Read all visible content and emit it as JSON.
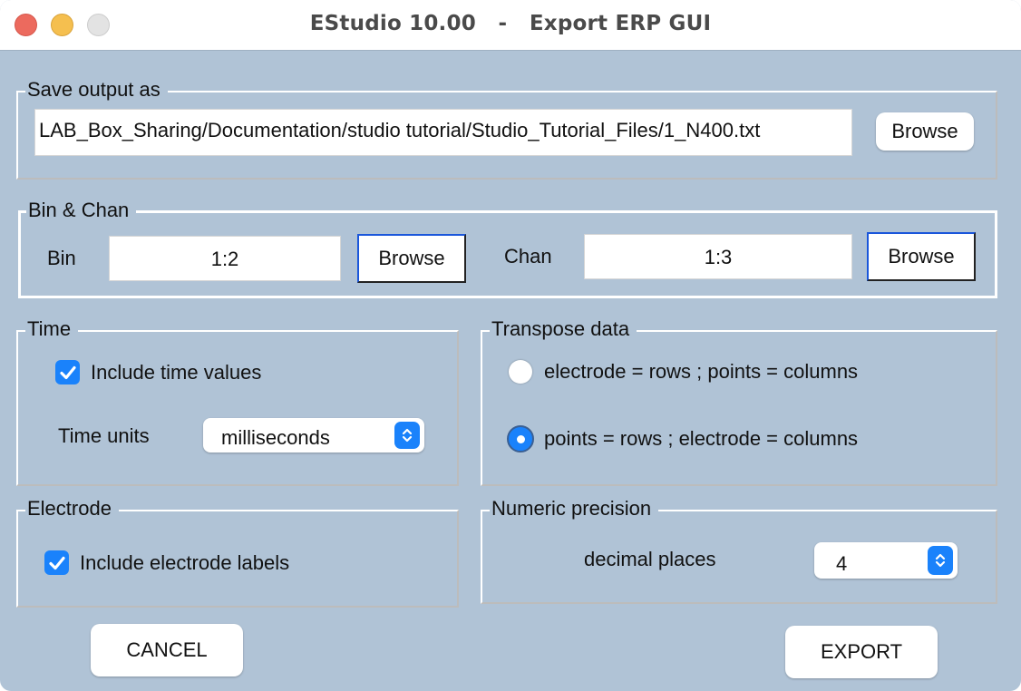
{
  "window": {
    "title": "EStudio 10.00   -   Export ERP GUI",
    "controls": [
      "close",
      "minimize",
      "maximize"
    ]
  },
  "save_output": {
    "title": "Save output as",
    "path_value": "LAB_Box_Sharing/Documentation/studio tutorial/Studio_Tutorial_Files/1_N400.txt",
    "browse_label": "Browse"
  },
  "bin_chan": {
    "title": "Bin & Chan",
    "bin_label": "Bin",
    "bin_value": "1:2",
    "bin_browse_label": "Browse",
    "chan_label": "Chan",
    "chan_value": "1:3",
    "chan_browse_label": "Browse"
  },
  "time": {
    "title": "Time",
    "include_time_label": "Include time values",
    "include_time_checked": true,
    "units_label": "Time units",
    "units_selected": "milliseconds"
  },
  "transpose": {
    "title": "Transpose data",
    "options": [
      {
        "label": "electrode = rows ; points = columns",
        "selected": false
      },
      {
        "label": "points = rows ; electrode = columns",
        "selected": true
      }
    ]
  },
  "electrode": {
    "title": "Electrode",
    "include_labels_label": "Include electrode labels",
    "include_labels_checked": true
  },
  "precision": {
    "title": "Numeric precision",
    "decimal_label": "decimal places",
    "decimal_selected": "4"
  },
  "footer": {
    "cancel_label": "CANCEL",
    "export_label": "EXPORT"
  },
  "colors": {
    "background": "#b0c3d6",
    "accent": "#1a82fb",
    "close": "#ec6a5e",
    "minimize": "#f5bf4f"
  }
}
